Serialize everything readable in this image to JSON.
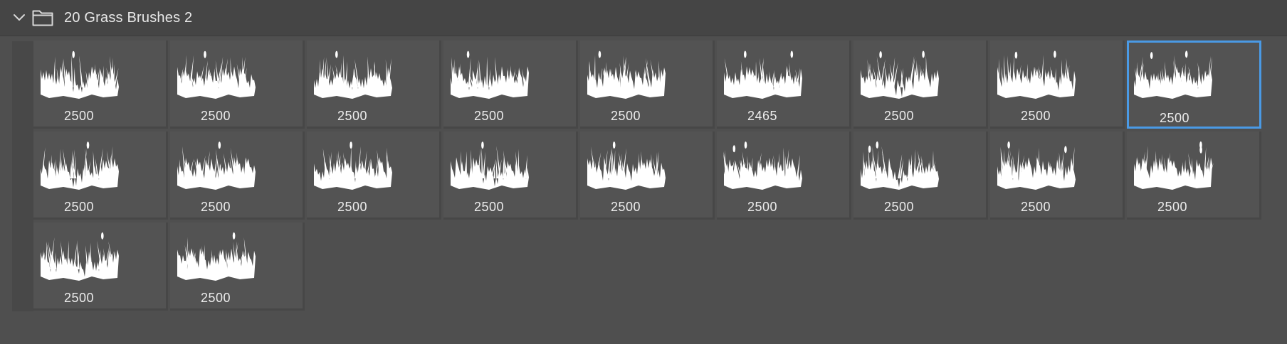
{
  "group": {
    "name": "20 Grass Brushes 2",
    "expanded": true,
    "icons": [
      "chevron-down-icon",
      "folder-icon"
    ]
  },
  "colors": {
    "selection": "#4a9ae5",
    "background": "#4f4f4f",
    "thumbnail": "#ffffff"
  },
  "brushes": [
    {
      "size": "2500",
      "selected": false,
      "icon": "grass-brush-icon"
    },
    {
      "size": "2500",
      "selected": false,
      "icon": "grass-brush-icon"
    },
    {
      "size": "2500",
      "selected": false,
      "icon": "grass-brush-icon"
    },
    {
      "size": "2500",
      "selected": false,
      "icon": "grass-brush-icon"
    },
    {
      "size": "2500",
      "selected": false,
      "icon": "grass-brush-icon"
    },
    {
      "size": "2465",
      "selected": false,
      "icon": "grass-brush-icon"
    },
    {
      "size": "2500",
      "selected": false,
      "icon": "grass-brush-icon"
    },
    {
      "size": "2500",
      "selected": false,
      "icon": "grass-brush-icon"
    },
    {
      "size": "2500",
      "selected": true,
      "icon": "grass-brush-icon"
    },
    {
      "size": "2500",
      "selected": false,
      "icon": "grass-brush-icon"
    },
    {
      "size": "2500",
      "selected": false,
      "icon": "grass-brush-icon"
    },
    {
      "size": "2500",
      "selected": false,
      "icon": "grass-brush-icon"
    },
    {
      "size": "2500",
      "selected": false,
      "icon": "grass-brush-icon"
    },
    {
      "size": "2500",
      "selected": false,
      "icon": "grass-brush-icon"
    },
    {
      "size": "2500",
      "selected": false,
      "icon": "grass-brush-icon"
    },
    {
      "size": "2500",
      "selected": false,
      "icon": "grass-brush-icon"
    },
    {
      "size": "2500",
      "selected": false,
      "icon": "grass-brush-icon"
    },
    {
      "size": "2500",
      "selected": false,
      "icon": "grass-brush-icon"
    },
    {
      "size": "2500",
      "selected": false,
      "icon": "grass-brush-icon"
    },
    {
      "size": "2500",
      "selected": false,
      "icon": "grass-brush-icon"
    }
  ]
}
